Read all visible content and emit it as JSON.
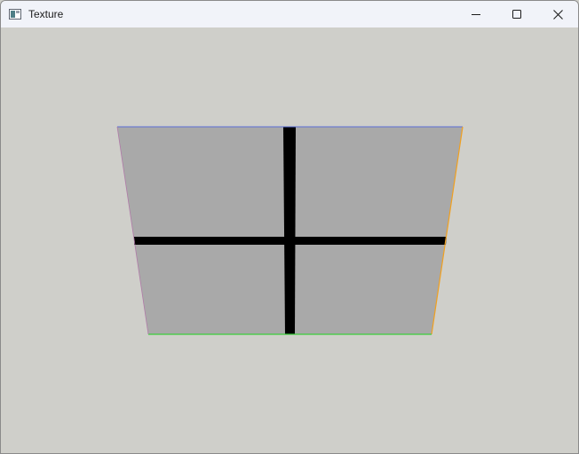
{
  "window": {
    "title": "Texture",
    "icon": "app-window-icon",
    "controls": {
      "minimize_icon": "minimize-icon",
      "maximize_icon": "maximize-icon",
      "close_icon": "close-icon"
    }
  },
  "scene": {
    "background_color": "#cfcfca",
    "quad_fill": "#a9a9a9",
    "cross_color": "#000000",
    "edge_colors": {
      "top": "#5b6ed6",
      "right": "#f0a020",
      "bottom": "#3ccf3c",
      "left": "#b07aa8"
    }
  }
}
